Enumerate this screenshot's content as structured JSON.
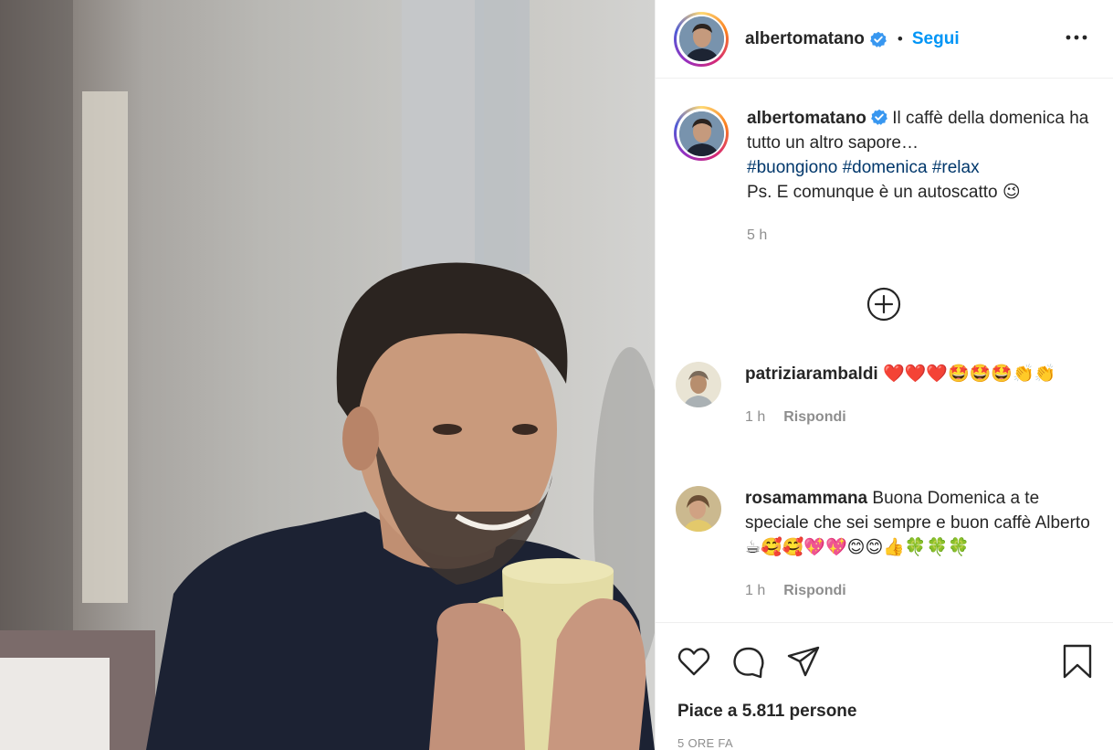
{
  "post": {
    "image_alt": "Man with curly hair holding a yellow mug"
  },
  "header": {
    "username": "albertomatano",
    "separator": "•",
    "follow_label": "Segui",
    "more_icon": "more-horizontal-icon",
    "verified_icon": "verified-badge-icon"
  },
  "caption": {
    "username": "albertomatano",
    "text_line1": " Il caffè della domenica ha tutto un altro sapore…",
    "hashtags": [
      "#buongiono",
      "#domenica",
      "#relax"
    ],
    "text_line2": "Ps. E comunque è un autoscatto 😉",
    "time": "5 h"
  },
  "load_more_icon": "plus-circle-icon",
  "comments": [
    {
      "username": "patriziarambaldi",
      "text": " ❤️❤️❤️🤩🤩🤩👏👏",
      "time": "1 h",
      "reply_label": "Rispondi"
    },
    {
      "username": "rosamammana",
      "text": " Buona Domenica a te speciale che sei sempre e buon caffè Alberto ☕🥰🥰💖💖😊😊👍🍀🍀🍀",
      "time": "1 h",
      "reply_label": "Rispondi"
    }
  ],
  "actions": {
    "like_icon": "heart-icon",
    "comment_icon": "comment-icon",
    "share_icon": "share-icon",
    "save_icon": "bookmark-icon"
  },
  "likes_text": "Piace a 5.811 persone",
  "posted_ago": "5 ORE FA",
  "colors": {
    "accent": "#0095f6",
    "hashtag": "#00376b",
    "muted": "#8e8e8e",
    "text": "#262626"
  }
}
